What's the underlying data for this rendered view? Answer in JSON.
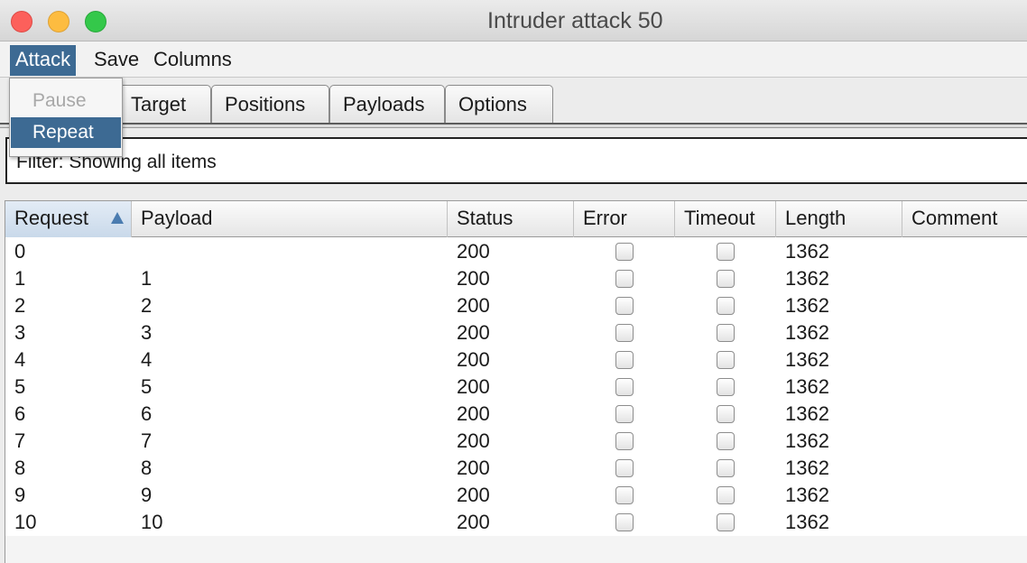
{
  "window": {
    "title": "Intruder attack 50"
  },
  "menubar": {
    "items": [
      "Attack",
      "Save",
      "Columns"
    ]
  },
  "attack_menu": {
    "items": [
      {
        "label": "Pause",
        "enabled": false
      },
      {
        "label": "Repeat",
        "enabled": true
      }
    ]
  },
  "tabs": [
    "Target",
    "Positions",
    "Payloads",
    "Options"
  ],
  "filter": {
    "text": "Filter: Showing all items"
  },
  "table": {
    "columns": [
      "Request",
      "Payload",
      "Status",
      "Error",
      "Timeout",
      "Length",
      "Comment"
    ],
    "sorted_by": "Request",
    "rows": [
      {
        "request": "0",
        "payload": "",
        "status": "200",
        "error": false,
        "timeout": false,
        "length": "1362",
        "comment": ""
      },
      {
        "request": "1",
        "payload": "1",
        "status": "200",
        "error": false,
        "timeout": false,
        "length": "1362",
        "comment": ""
      },
      {
        "request": "2",
        "payload": "2",
        "status": "200",
        "error": false,
        "timeout": false,
        "length": "1362",
        "comment": ""
      },
      {
        "request": "3",
        "payload": "3",
        "status": "200",
        "error": false,
        "timeout": false,
        "length": "1362",
        "comment": ""
      },
      {
        "request": "4",
        "payload": "4",
        "status": "200",
        "error": false,
        "timeout": false,
        "length": "1362",
        "comment": ""
      },
      {
        "request": "5",
        "payload": "5",
        "status": "200",
        "error": false,
        "timeout": false,
        "length": "1362",
        "comment": ""
      },
      {
        "request": "6",
        "payload": "6",
        "status": "200",
        "error": false,
        "timeout": false,
        "length": "1362",
        "comment": ""
      },
      {
        "request": "7",
        "payload": "7",
        "status": "200",
        "error": false,
        "timeout": false,
        "length": "1362",
        "comment": ""
      },
      {
        "request": "8",
        "payload": "8",
        "status": "200",
        "error": false,
        "timeout": false,
        "length": "1362",
        "comment": ""
      },
      {
        "request": "9",
        "payload": "9",
        "status": "200",
        "error": false,
        "timeout": false,
        "length": "1362",
        "comment": ""
      },
      {
        "request": "10",
        "payload": "10",
        "status": "200",
        "error": false,
        "timeout": false,
        "length": "1362",
        "comment": ""
      }
    ]
  }
}
